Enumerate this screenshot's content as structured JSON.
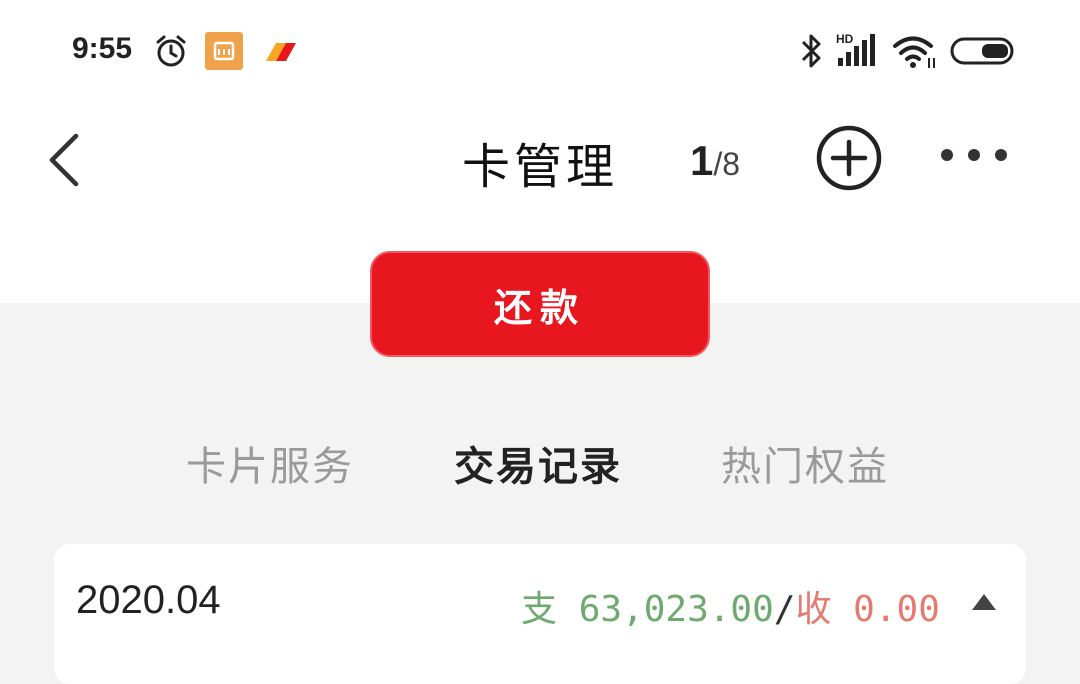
{
  "status_bar": {
    "time": "9:55",
    "icons": [
      "alarm-icon",
      "mi-app-icon",
      "app-logo-icon",
      "bluetooth-icon",
      "signal-hd-icon",
      "wifi-icon",
      "battery-icon"
    ],
    "network_label": "HD"
  },
  "header": {
    "title": "卡管理",
    "pager_current": "1",
    "pager_separator": "/",
    "pager_total": "8"
  },
  "actions": {
    "repay_label": "还款"
  },
  "tabs": [
    {
      "label": "卡片服务",
      "active": false
    },
    {
      "label": "交易记录",
      "active": true
    },
    {
      "label": "热门权益",
      "active": false
    }
  ],
  "records": {
    "month": "2020.04",
    "out_label": "支",
    "out_amount": "63,023.00",
    "separator": "/",
    "in_label": "收",
    "in_amount": "0.00"
  },
  "colors": {
    "accent_red": "#e8161f",
    "expense_green": "#6ea96e",
    "income_red": "#e57a6f"
  }
}
